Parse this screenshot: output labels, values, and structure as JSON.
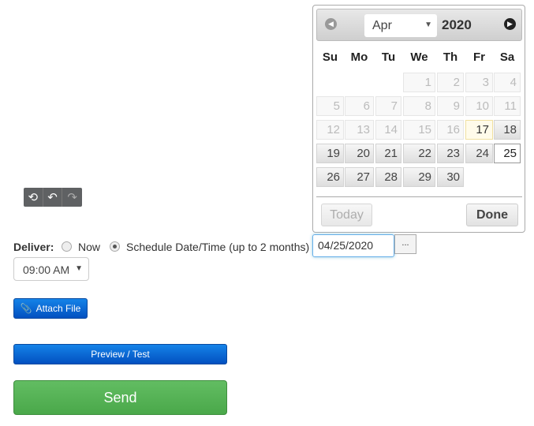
{
  "toolbar": {
    "icons": [
      "history-icon",
      "undo-icon",
      "redo-icon"
    ]
  },
  "calendar": {
    "month": "Apr",
    "year": "2020",
    "weekdays": [
      "Su",
      "Mo",
      "Tu",
      "We",
      "Th",
      "Fr",
      "Sa"
    ],
    "weeks": [
      [
        null,
        null,
        null,
        {
          "d": "1",
          "s": "dis"
        },
        {
          "d": "2",
          "s": "dis"
        },
        {
          "d": "3",
          "s": "dis"
        },
        {
          "d": "4",
          "s": "dis"
        }
      ],
      [
        {
          "d": "5",
          "s": "dis"
        },
        {
          "d": "6",
          "s": "dis"
        },
        {
          "d": "7",
          "s": "dis"
        },
        {
          "d": "8",
          "s": "dis"
        },
        {
          "d": "9",
          "s": "dis"
        },
        {
          "d": "10",
          "s": "dis"
        },
        {
          "d": "11",
          "s": "dis"
        }
      ],
      [
        {
          "d": "12",
          "s": "dis"
        },
        {
          "d": "13",
          "s": "dis"
        },
        {
          "d": "14",
          "s": "dis"
        },
        {
          "d": "15",
          "s": "dis"
        },
        {
          "d": "16",
          "s": "dis"
        },
        {
          "d": "17",
          "s": "today"
        },
        {
          "d": "18",
          "s": ""
        }
      ],
      [
        {
          "d": "19",
          "s": ""
        },
        {
          "d": "20",
          "s": ""
        },
        {
          "d": "21",
          "s": ""
        },
        {
          "d": "22",
          "s": ""
        },
        {
          "d": "23",
          "s": ""
        },
        {
          "d": "24",
          "s": ""
        },
        {
          "d": "25",
          "s": "sel"
        }
      ],
      [
        {
          "d": "26",
          "s": ""
        },
        {
          "d": "27",
          "s": ""
        },
        {
          "d": "28",
          "s": ""
        },
        {
          "d": "29",
          "s": ""
        },
        {
          "d": "30",
          "s": ""
        },
        null,
        null
      ]
    ],
    "today_label": "Today",
    "done_label": "Done"
  },
  "deliver": {
    "label": "Deliver:",
    "now_label": "Now",
    "schedule_label": "Schedule Date/Time (up to 2 months)",
    "selected": "schedule",
    "date_value": "04/25/2020",
    "picker_label": "...",
    "time_value": "09:00 AM"
  },
  "buttons": {
    "attach": "Attach File",
    "preview": "Preview / Test",
    "send": "Send"
  },
  "colors": {
    "primary": "#0a6ad8",
    "success": "#55b455"
  }
}
